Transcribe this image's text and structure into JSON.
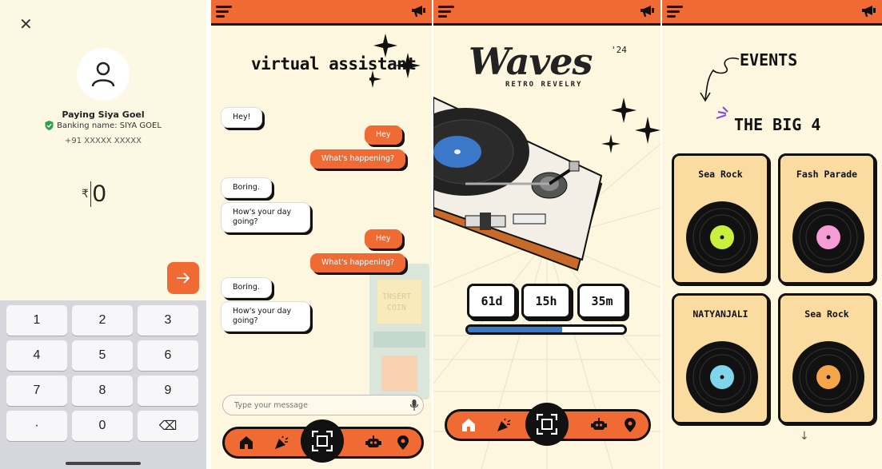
{
  "payment": {
    "close_icon": "close-icon",
    "payee": "Paying Siya Goel",
    "banking_name": "Banking name: SIYA GOEL",
    "phone": "+91 XXXXX XXXXX",
    "currency": "₹",
    "amount": "0",
    "keypad": [
      [
        "1",
        "2",
        "3"
      ],
      [
        "4",
        "5",
        "6"
      ],
      [
        "7",
        "8",
        "9"
      ],
      [
        "·",
        "0",
        "⌫"
      ]
    ],
    "accent": "#f06a34"
  },
  "chat": {
    "title": "virtual assistant",
    "messages": [
      {
        "from": "bot",
        "text": "Hey!"
      },
      {
        "from": "user",
        "text": "Hey"
      },
      {
        "from": "user",
        "text": "What's happening?"
      },
      {
        "from": "bot",
        "text": "Boring."
      },
      {
        "from": "bot",
        "text": "How's your day going?"
      },
      {
        "from": "user",
        "text": "Hey"
      },
      {
        "from": "user",
        "text": "What's happening?"
      },
      {
        "from": "bot",
        "text": "Boring."
      },
      {
        "from": "bot",
        "text": "How's your day going?"
      }
    ],
    "input_placeholder": "Type your message"
  },
  "home": {
    "logo": "Waves",
    "logo_sup": "'24",
    "subtitle": "RETRO REVELRY",
    "countdown": {
      "days": "61d",
      "hours": "15h",
      "minutes": "35m"
    },
    "progress": 0.6
  },
  "events": {
    "title": "EVENTS",
    "subtitle": "THE BIG 4",
    "items": [
      {
        "name": "Sea Rock",
        "label_color": "#c8f03c"
      },
      {
        "name": "Fash Parade",
        "label_color": "#f59bd6"
      },
      {
        "name": "NATYANJALI",
        "label_color": "#7fd6ea"
      },
      {
        "name": "Sea Rock",
        "label_color": "#f5a64a"
      }
    ]
  },
  "nav_icons": [
    "home-icon",
    "party-icon",
    "scan-icon",
    "robot-icon",
    "location-icon"
  ],
  "colors": {
    "orange": "#f06a34",
    "cream": "#fdf7e0",
    "card": "#fbdca0",
    "blue": "#3b78c9"
  }
}
